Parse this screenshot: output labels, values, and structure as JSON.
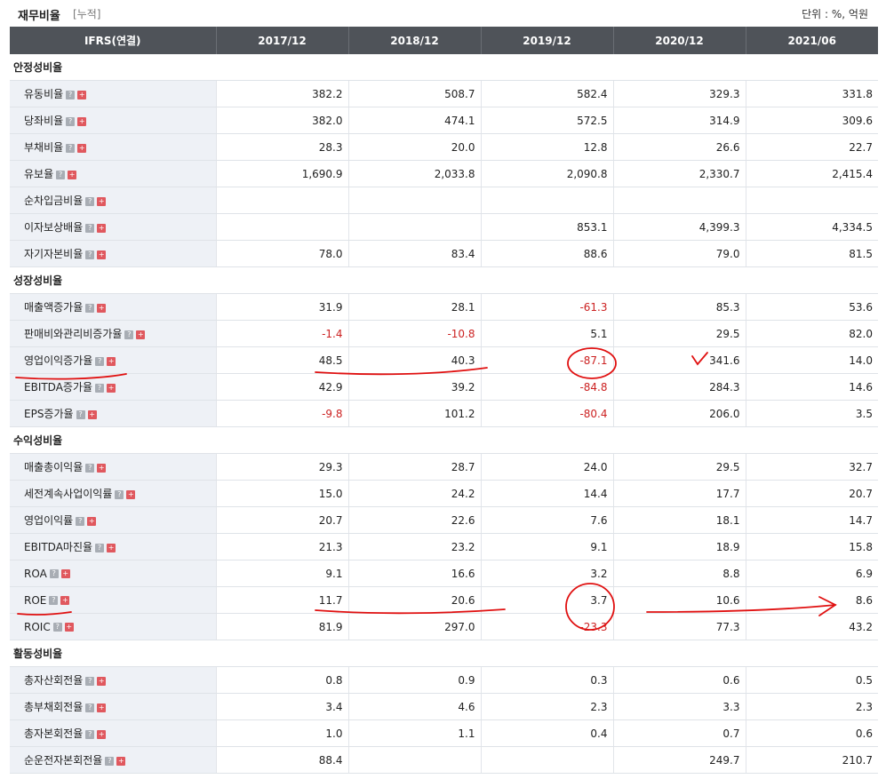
{
  "header": {
    "title": "재무비율",
    "subtitle": "[누적]",
    "unit": "단위 : %, 억원"
  },
  "columns": [
    "IFRS(연결)",
    "2017/12",
    "2018/12",
    "2019/12",
    "2020/12",
    "2021/06"
  ],
  "icons": {
    "help": "?",
    "plus": "+"
  },
  "sections": [
    {
      "title": "안정성비율",
      "rows": [
        {
          "label": "유동비율",
          "values": [
            "382.2",
            "508.7",
            "582.4",
            "329.3",
            "331.8"
          ]
        },
        {
          "label": "당좌비율",
          "values": [
            "382.0",
            "474.1",
            "572.5",
            "314.9",
            "309.6"
          ]
        },
        {
          "label": "부채비율",
          "values": [
            "28.3",
            "20.0",
            "12.8",
            "26.6",
            "22.7"
          ]
        },
        {
          "label": "유보율",
          "values": [
            "1,690.9",
            "2,033.8",
            "2,090.8",
            "2,330.7",
            "2,415.4"
          ]
        },
        {
          "label": "순차입금비율",
          "values": [
            "",
            "",
            "",
            "",
            ""
          ]
        },
        {
          "label": "이자보상배율",
          "values": [
            "",
            "",
            "853.1",
            "4,399.3",
            "4,334.5"
          ]
        },
        {
          "label": "자기자본비율",
          "values": [
            "78.0",
            "83.4",
            "88.6",
            "79.0",
            "81.5"
          ]
        }
      ]
    },
    {
      "title": "성장성비율",
      "rows": [
        {
          "label": "매출액증가율",
          "values": [
            "31.9",
            "28.1",
            "-61.3",
            "85.3",
            "53.6"
          ]
        },
        {
          "label": "판매비와관리비증가율",
          "values": [
            "-1.4",
            "-10.8",
            "5.1",
            "29.5",
            "82.0"
          ]
        },
        {
          "label": "영업이익증가율",
          "values": [
            "48.5",
            "40.3",
            "-87.1",
            "341.6",
            "14.0"
          ]
        },
        {
          "label": "EBITDA증가율",
          "values": [
            "42.9",
            "39.2",
            "-84.8",
            "284.3",
            "14.6"
          ]
        },
        {
          "label": "EPS증가율",
          "values": [
            "-9.8",
            "101.2",
            "-80.4",
            "206.0",
            "3.5"
          ]
        }
      ]
    },
    {
      "title": "수익성비율",
      "rows": [
        {
          "label": "매출총이익율",
          "values": [
            "29.3",
            "28.7",
            "24.0",
            "29.5",
            "32.7"
          ]
        },
        {
          "label": "세전계속사업이익률",
          "values": [
            "15.0",
            "24.2",
            "14.4",
            "17.7",
            "20.7"
          ]
        },
        {
          "label": "영업이익률",
          "values": [
            "20.7",
            "22.6",
            "7.6",
            "18.1",
            "14.7"
          ]
        },
        {
          "label": "EBITDA마진율",
          "values": [
            "21.3",
            "23.2",
            "9.1",
            "18.9",
            "15.8"
          ]
        },
        {
          "label": "ROA",
          "values": [
            "9.1",
            "16.6",
            "3.2",
            "8.8",
            "6.9"
          ]
        },
        {
          "label": "ROE",
          "values": [
            "11.7",
            "20.6",
            "3.7",
            "10.6",
            "8.6"
          ]
        },
        {
          "label": "ROIC",
          "values": [
            "81.9",
            "297.0",
            "-23.3",
            "77.3",
            "43.2"
          ]
        }
      ]
    },
    {
      "title": "활동성비율",
      "rows": [
        {
          "label": "총자산회전율",
          "values": [
            "0.8",
            "0.9",
            "0.3",
            "0.6",
            "0.5"
          ]
        },
        {
          "label": "총부채회전율",
          "values": [
            "3.4",
            "4.6",
            "2.3",
            "3.3",
            "2.3"
          ]
        },
        {
          "label": "총자본회전율",
          "values": [
            "1.0",
            "1.1",
            "0.4",
            "0.7",
            "0.6"
          ]
        },
        {
          "label": "순운전자본회전율",
          "values": [
            "88.4",
            "",
            "",
            "249.7",
            "210.7"
          ]
        }
      ]
    }
  ],
  "colors": {
    "header_bg": "#4f5359",
    "label_bg": "#eef1f6",
    "negative": "#cc2222",
    "annotation": "#e01010"
  }
}
